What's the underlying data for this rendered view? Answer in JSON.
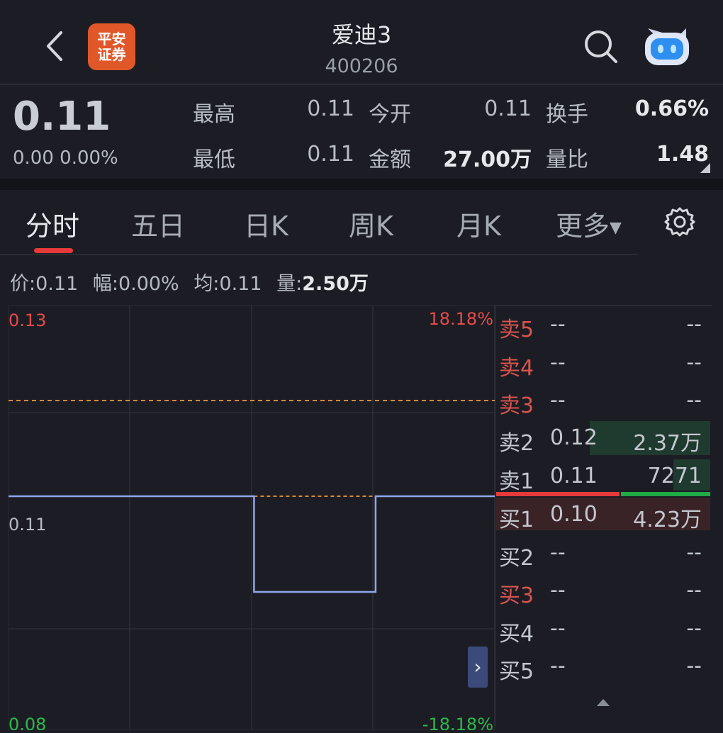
{
  "header": {
    "back_icon": "chevron-left-icon",
    "logo_line1": "平安",
    "logo_line2": "证券",
    "stock_name": "爱迪3",
    "stock_code": "400206",
    "search_icon": "search-icon",
    "assistant_icon": "robot-icon"
  },
  "quote": {
    "price": "0.11",
    "change": "0.00 0.00%",
    "high_label": "最高",
    "high_value": "0.11",
    "open_label": "今开",
    "open_value": "0.11",
    "turnover_label": "换手",
    "turnover_value": "0.66%",
    "low_label": "最低",
    "low_value": "0.11",
    "amount_label": "金额",
    "amount_value": "27.00万",
    "volratio_label": "量比",
    "volratio_value": "1.48"
  },
  "tabs": [
    "分时",
    "五日",
    "日K",
    "周K",
    "月K",
    "更多"
  ],
  "active_tab": 0,
  "info_bar": {
    "price_label": "价:",
    "price_value": "0.11",
    "range_label": "幅:",
    "range_value": "0.00%",
    "avg_label": "均:",
    "avg_value": "0.11",
    "volume_label": "量:",
    "volume_value": "2.50万"
  },
  "chart_data": {
    "type": "line",
    "y_top_label": "0.13",
    "y_top_pct": "18.18%",
    "y_mid_label": "0.11",
    "y_bottom_label": "0.08",
    "y_bottom_pct": "-18.18%",
    "ylim": [
      0.09,
      0.13
    ],
    "series": [
      {
        "x": [
          0,
          0.505,
          0.505,
          0.755,
          0.755,
          1.0
        ],
        "values": [
          0.11,
          0.11,
          0.1,
          0.1,
          0.11,
          0.11
        ]
      }
    ],
    "avg_line": 0.11,
    "limit_line": 0.12,
    "grid": true
  },
  "order_book": {
    "asks": [
      {
        "label": "卖5",
        "price": "--",
        "volume": "--"
      },
      {
        "label": "卖4",
        "price": "--",
        "volume": "--"
      },
      {
        "label": "卖3",
        "price": "--",
        "volume": "--"
      },
      {
        "label": "卖2",
        "price": "0.12",
        "volume": "2.37万"
      },
      {
        "label": "卖1",
        "price": "0.11",
        "volume": "7271"
      }
    ],
    "bids": [
      {
        "label": "买1",
        "price": "0.10",
        "volume": "4.23万"
      },
      {
        "label": "买2",
        "price": "--",
        "volume": "--"
      },
      {
        "label": "买3",
        "price": "--",
        "volume": "--"
      },
      {
        "label": "买4",
        "price": "--",
        "volume": "--"
      },
      {
        "label": "买5",
        "price": "--",
        "volume": "--"
      }
    ]
  },
  "colors": {
    "up": "#e64a4a",
    "down": "#2eb84b",
    "line": "#8fa6e8",
    "avg": "#d98a2b"
  }
}
